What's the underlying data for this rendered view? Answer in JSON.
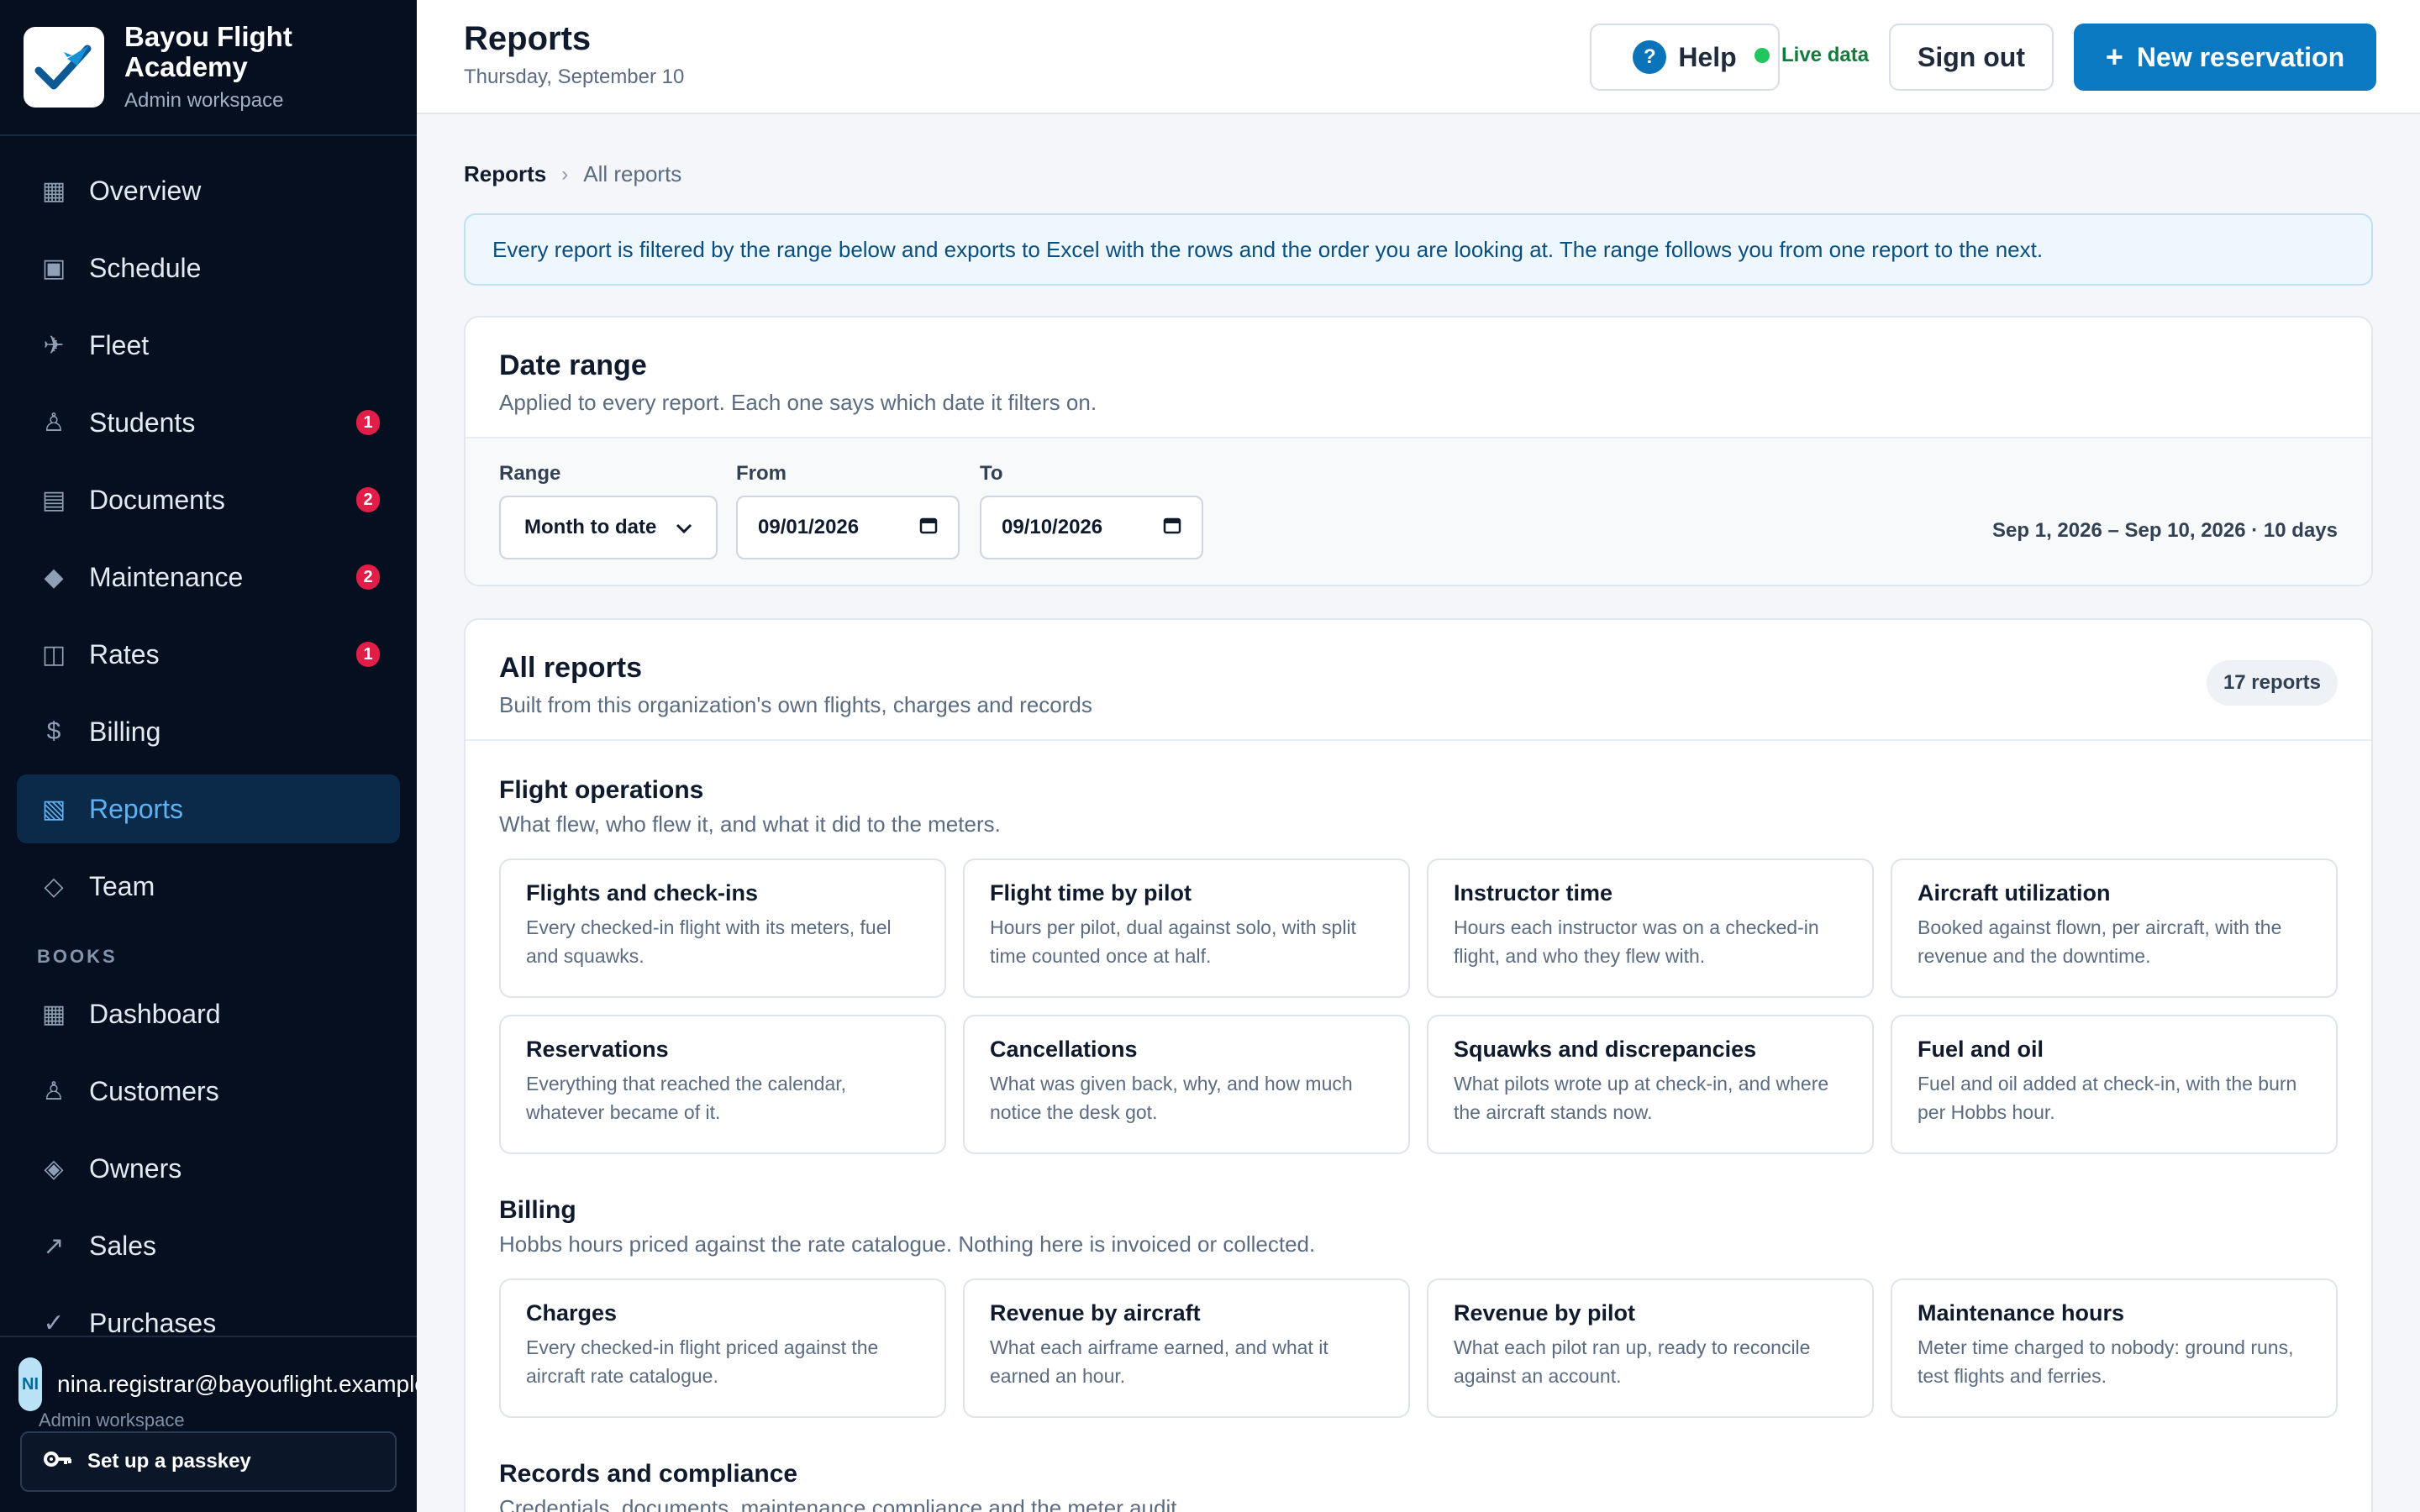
{
  "brand": {
    "name": "Bayou Flight Academy",
    "subtitle": "Admin workspace"
  },
  "nav": {
    "items": [
      {
        "label": "Overview",
        "icon": "grid-icon",
        "glyph": "▦"
      },
      {
        "label": "Schedule",
        "icon": "calendar-icon",
        "glyph": "▣"
      },
      {
        "label": "Fleet",
        "icon": "plane-icon",
        "glyph": "✈"
      },
      {
        "label": "Students",
        "icon": "student-icon",
        "glyph": "♙",
        "badge": "1"
      },
      {
        "label": "Documents",
        "icon": "document-icon",
        "glyph": "▤",
        "badge": "2"
      },
      {
        "label": "Maintenance",
        "icon": "wrench-icon",
        "glyph": "◆",
        "badge": "2"
      },
      {
        "label": "Rates",
        "icon": "rates-icon",
        "glyph": "◫",
        "badge": "1"
      },
      {
        "label": "Billing",
        "icon": "dollar-icon",
        "glyph": "$"
      },
      {
        "label": "Reports",
        "icon": "reports-icon",
        "glyph": "▧",
        "active": true
      },
      {
        "label": "Team",
        "icon": "team-icon",
        "glyph": "◇"
      }
    ],
    "books_section": "BOOKS",
    "books_items": [
      {
        "label": "Dashboard",
        "icon": "dashboard-icon",
        "glyph": "▦"
      },
      {
        "label": "Customers",
        "icon": "customers-icon",
        "glyph": "♙"
      },
      {
        "label": "Owners",
        "icon": "owners-icon",
        "glyph": "◈"
      },
      {
        "label": "Sales",
        "icon": "sales-icon",
        "glyph": "↗"
      },
      {
        "label": "Purchases",
        "icon": "purchases-icon",
        "glyph": "✓"
      }
    ]
  },
  "user": {
    "initials": "NI",
    "email": "nina.registrar@bayouflight.example",
    "role": "Admin workspace",
    "passkey_label": "Set up a passkey"
  },
  "header": {
    "title": "Reports",
    "date": "Thursday, September 10",
    "help_label": "Help",
    "live_label": "Live data",
    "signout_label": "Sign out",
    "new_label": "New reservation"
  },
  "breadcrumb": {
    "root": "Reports",
    "current": "All reports"
  },
  "banner": "Every report is filtered by the range below and exports to Excel with the rows and the order you are looking at. The range follows you from one report to the next.",
  "date_range": {
    "title": "Date range",
    "subtitle": "Applied to every report. Each one says which date it filters on.",
    "range_label": "Range",
    "range_value": "Month to date",
    "from_label": "From",
    "from_value": "09/01/2026",
    "to_label": "To",
    "to_value": "09/10/2026",
    "summary": "Sep 1, 2026 – Sep 10, 2026 · 10 days"
  },
  "reports": {
    "title": "All reports",
    "subtitle": "Built from this organization's own flights, charges and records",
    "count": "17 reports",
    "groups": [
      {
        "title": "Flight operations",
        "desc": "What flew, who flew it, and what it did to the meters.",
        "items": [
          {
            "name": "Flights and check-ins",
            "desc": "Every checked-in flight with its meters, fuel and squawks."
          },
          {
            "name": "Flight time by pilot",
            "desc": "Hours per pilot, dual against solo, with split time counted once at half."
          },
          {
            "name": "Instructor time",
            "desc": "Hours each instructor was on a checked-in flight, and who they flew with."
          },
          {
            "name": "Aircraft utilization",
            "desc": "Booked against flown, per aircraft, with the revenue and the downtime."
          },
          {
            "name": "Reservations",
            "desc": "Everything that reached the calendar, whatever became of it."
          },
          {
            "name": "Cancellations",
            "desc": "What was given back, why, and how much notice the desk got."
          },
          {
            "name": "Squawks and discrepancies",
            "desc": "What pilots wrote up at check-in, and where the aircraft stands now."
          },
          {
            "name": "Fuel and oil",
            "desc": "Fuel and oil added at check-in, with the burn per Hobbs hour."
          }
        ]
      },
      {
        "title": "Billing",
        "desc": "Hobbs hours priced against the rate catalogue. Nothing here is invoiced or collected.",
        "items": [
          {
            "name": "Charges",
            "desc": "Every checked-in flight priced against the aircraft rate catalogue."
          },
          {
            "name": "Revenue by aircraft",
            "desc": "What each airframe earned, and what it earned an hour."
          },
          {
            "name": "Revenue by pilot",
            "desc": "What each pilot ran up, ready to reconcile against an account."
          },
          {
            "name": "Maintenance hours",
            "desc": "Meter time charged to nobody: ground runs, test flights and ferries."
          }
        ]
      },
      {
        "title": "Records and compliance",
        "desc": "Credentials, documents, maintenance compliance and the meter audit."
      }
    ]
  }
}
